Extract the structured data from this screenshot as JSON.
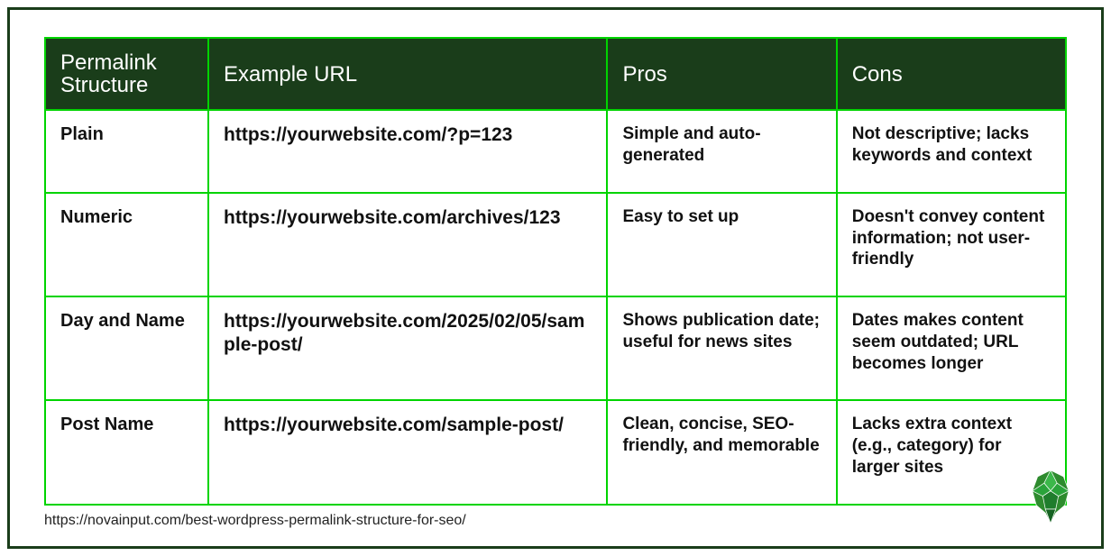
{
  "table": {
    "headers": {
      "structure": "Permalink Structure",
      "example": "Example URL",
      "pros": "Pros",
      "cons": "Cons"
    },
    "rows": [
      {
        "structure": "Plain",
        "example": "https://yourwebsite.com/?p=123",
        "pros": "Simple and auto-generated",
        "cons": "Not descriptive; lacks keywords and context"
      },
      {
        "structure": "Numeric",
        "example": "https://yourwebsite.com/archives/123",
        "pros": "Easy to set up",
        "cons": "Doesn't convey content information; not user-friendly"
      },
      {
        "structure": "Day and Name",
        "example": "https://yourwebsite.com/2025/02/05/sample-post/",
        "pros": "Shows publication date; useful for news sites",
        "cons": "Dates makes content seem outdated; URL becomes longer"
      },
      {
        "structure": "Post Name",
        "example": "https://yourwebsite.com/sample-post/",
        "pros": "Clean, concise, SEO-friendly, and memorable",
        "cons": "Lacks extra context (e.g., category) for larger sites"
      }
    ]
  },
  "source_url": "https://novainput.com/best-wordpress-permalink-structure-for-seo/"
}
